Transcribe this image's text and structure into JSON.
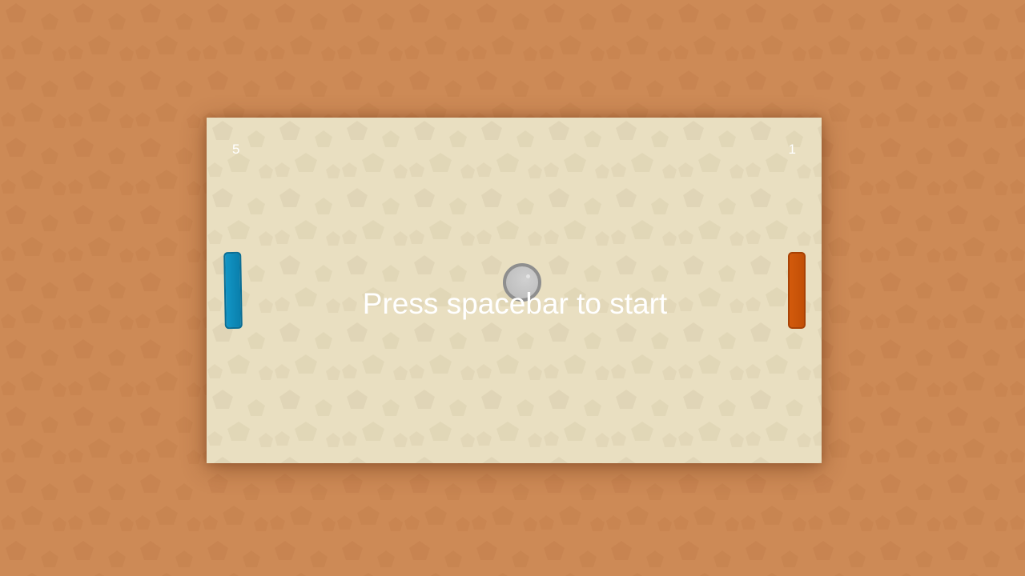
{
  "game": {
    "score_left": "5",
    "score_right": "1",
    "start_message": "Press spacebar to start"
  },
  "colors": {
    "background": "#cd8a56",
    "board": "#e9dfc1",
    "paddle_left": "#0a7fac",
    "paddle_right": "#c24f06",
    "ball": "#c2c2c2"
  },
  "icons": {
    "ball": "ball-icon"
  }
}
